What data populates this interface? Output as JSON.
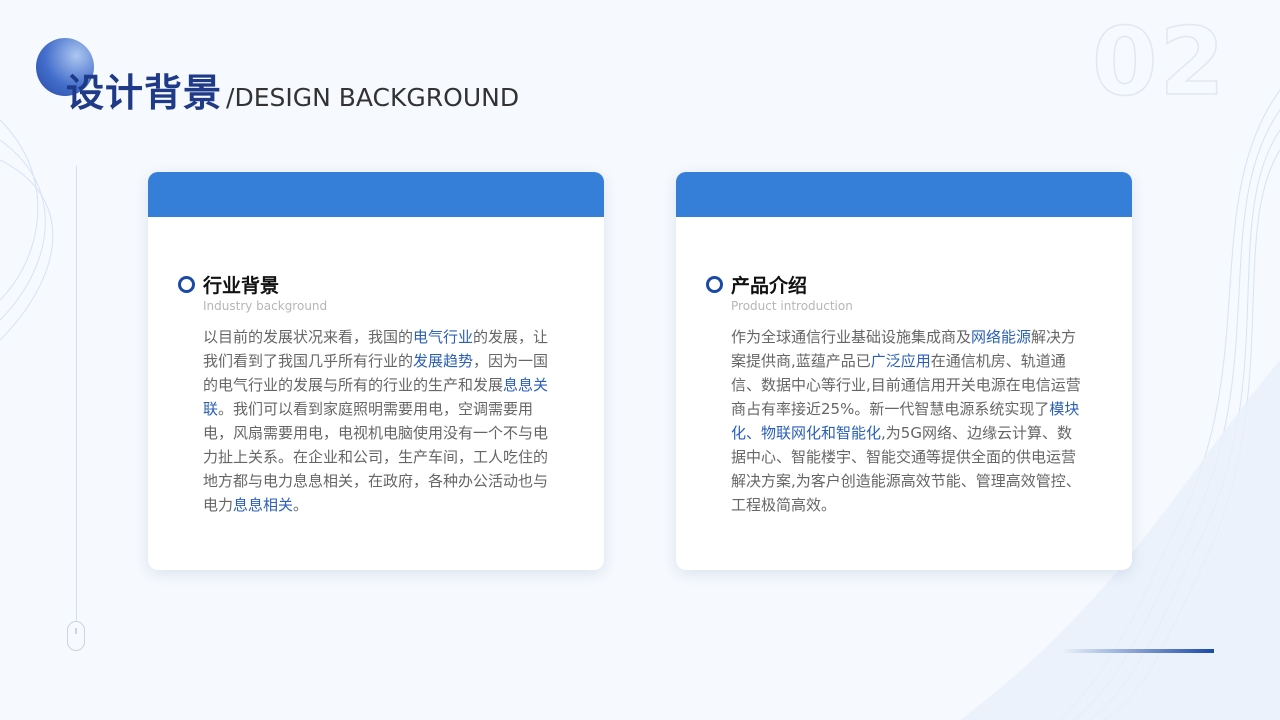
{
  "header": {
    "title_cn": "设计背景",
    "title_en": "/DESIGN BACKGROUND",
    "page_number": "02"
  },
  "cards": [
    {
      "title": "行业背景",
      "subtitle": "Industry background",
      "segments": [
        {
          "text": "以目前的发展状况来看，我国的",
          "hl": false
        },
        {
          "text": "电气行业",
          "hl": true
        },
        {
          "text": "的发展，让我们看到了我国几乎所有行业的",
          "hl": false
        },
        {
          "text": "发展趋势",
          "hl": true
        },
        {
          "text": "，因为一国的电气行业的发展与所有的行业的生产和发展",
          "hl": false
        },
        {
          "text": "息息关联",
          "hl": true
        },
        {
          "text": "。我们可以看到家庭照明需要用电，空调需要用电，风扇需要用电，电视机电脑使用没有一个不与电力扯上关系。在企业和公司，生产车间，工人吃住的地方都与电力息息相关，在政府，各种办公活动也与电力",
          "hl": false
        },
        {
          "text": "息息相关",
          "hl": true
        },
        {
          "text": "。",
          "hl": false
        }
      ]
    },
    {
      "title": "产品介绍",
      "subtitle": "Product introduction",
      "segments": [
        {
          "text": "作为全球通信行业基础设施集成商及",
          "hl": false
        },
        {
          "text": "网络能源",
          "hl": true
        },
        {
          "text": "解决方案提供商,蓝蕴产品已",
          "hl": false
        },
        {
          "text": "广泛应用",
          "hl": true
        },
        {
          "text": "在通信机房、轨道通信、数据中心等行业,目前通信用开关电源在电信运营商占有率接近25%。新一代智慧电源系统实现了",
          "hl": false
        },
        {
          "text": "模块化、物联网化和智能化",
          "hl": true
        },
        {
          "text": ",为5G网络、边缘云计算、数据中心、智能楼宇、智能交通等提供全面的供电运营解决方案,为客户创造能源高效节能、管理高效管控、工程极简高效。",
          "hl": false
        }
      ]
    }
  ],
  "colors": {
    "accent": "#357fd8",
    "title": "#1f3a86",
    "highlight": "#2b5fb8"
  },
  "icons": [
    "ring-bullet-icon",
    "mouse-scroll-icon",
    "logo-circle"
  ]
}
